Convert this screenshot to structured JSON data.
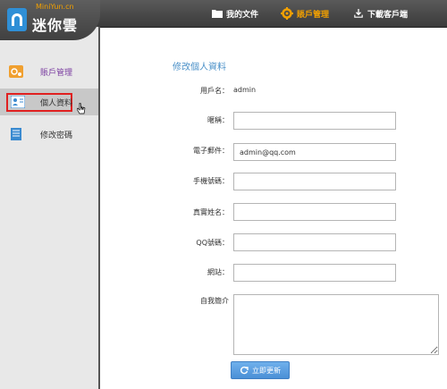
{
  "app": {
    "logo_subtitle": "MiniYun.cn",
    "logo_title": "迷你雲"
  },
  "topnav": [
    {
      "label": "我的文件",
      "icon": "folder-icon",
      "active": false
    },
    {
      "label": "賬戶管理",
      "icon": "gear-icon",
      "active": true
    },
    {
      "label": "下載客戶端",
      "icon": "download-icon",
      "active": false
    }
  ],
  "sidebar": {
    "header": "賬戶管理",
    "items": [
      {
        "label": "個人資料",
        "icon": "profile-card-icon",
        "selected": true
      },
      {
        "label": "修改密碼",
        "icon": "document-icon",
        "selected": false
      }
    ]
  },
  "form": {
    "title": "修改個人資料",
    "username_label": "用戶名：",
    "username_value": "admin",
    "nickname_label": "暱稱：",
    "nickname_value": "",
    "email_label": "電子郵件：",
    "email_value": "admin@qq.com",
    "phone_label": "手機號碼：",
    "phone_value": "",
    "realname_label": "真實姓名：",
    "realname_value": "",
    "qq_label": "QQ號碼：",
    "qq_value": "",
    "website_label": "網站：",
    "website_value": "",
    "bio_label": "自我簡介",
    "bio_value": "",
    "submit_label": "立即更新"
  },
  "colors": {
    "accent": "#f2a000",
    "title_blue": "#4a90c8",
    "button_blue": "#4a8fd6",
    "selection_red": "#e02020"
  }
}
